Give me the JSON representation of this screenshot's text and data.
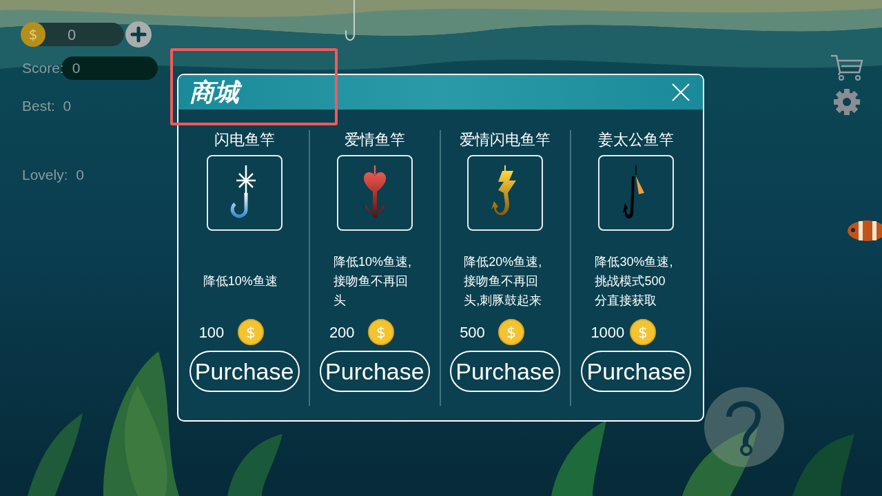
{
  "hud": {
    "coin_symbol": "$",
    "coins": "0",
    "score_label": "Score:",
    "score": "0",
    "best": "Best:  0",
    "lovely": "Lovely:  0"
  },
  "shop": {
    "title": "商城",
    "items": [
      {
        "name": "闪电鱼竿",
        "kind": "snowflake",
        "description": "降低10%鱼速",
        "price": "100",
        "coin_symbol": "$",
        "button": "Purchase"
      },
      {
        "name": "爱情鱼竿",
        "kind": "heart",
        "description": "降低10%鱼速,接吻鱼不再回头",
        "price": "200",
        "coin_symbol": "$",
        "button": "Purchase"
      },
      {
        "name": "爱情闪电鱼竿",
        "kind": "lightning",
        "description": "降低20%鱼速,接吻鱼不再回头,刺豚鼓起来",
        "price": "500",
        "coin_symbol": "$",
        "button": "Purchase"
      },
      {
        "name": "姜太公鱼竿",
        "kind": "tassel",
        "description": "降低30%鱼速,挑战模式500分直接获取",
        "price": "1000",
        "coin_symbol": "$",
        "button": "Purchase"
      }
    ]
  }
}
